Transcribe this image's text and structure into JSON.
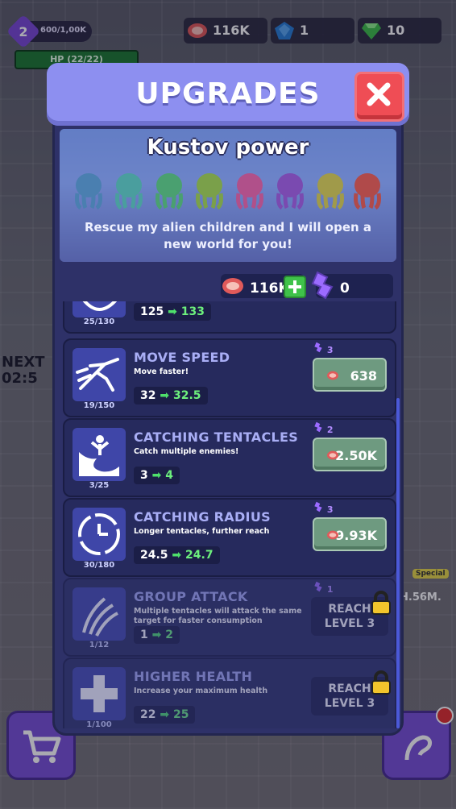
{
  "hud": {
    "level": "2",
    "xp": "600/1,00K",
    "hp": "HP (22/22)",
    "meat": "116K",
    "crystals": "1",
    "gems": "10"
  },
  "background": {
    "next_label": "NEXT",
    "timer": "02:5"
  },
  "dialog": {
    "title": "UPGRADES",
    "banner_title": "Kustov power",
    "banner_desc": "Rescue my alien children and I will open a new world for you!"
  },
  "currency": {
    "meat": "116K",
    "tokens": "0"
  },
  "upgrades": [
    {
      "name": "",
      "desc": "",
      "level": "25/130",
      "current": "125",
      "next": "133",
      "cost_tokens": "",
      "price": ""
    },
    {
      "name": "MOVE SPEED",
      "desc": "Move faster!",
      "level": "19/150",
      "current": "32",
      "next": "32.5",
      "cost_tokens": "3",
      "price": "638"
    },
    {
      "name": "CATCHING TENTACLES",
      "desc": "Catch multiple enemies!",
      "level": "3/25",
      "current": "3",
      "next": "4",
      "cost_tokens": "2",
      "price": "2.50K"
    },
    {
      "name": "CATCHING RADIUS",
      "desc": "Longer tentacles, further reach",
      "level": "30/180",
      "current": "24.5",
      "next": "24.7",
      "cost_tokens": "3",
      "price": "9.93K"
    },
    {
      "name": "GROUP ATTACK",
      "desc": "Multiple tentacles will attack the same target for faster consumption",
      "level": "1/12",
      "current": "1",
      "next": "2",
      "cost_tokens": "1",
      "locked_label_1": "REACH",
      "locked_label_2": "LEVEL 3"
    },
    {
      "name": "HIGHER HEALTH",
      "desc": "Increase your maximum health",
      "level": "1/100",
      "current": "22",
      "next": "25",
      "locked_label_1": "REACH",
      "locked_label_2": "LEVEL 3"
    }
  ],
  "side": {
    "special_tag": "Special",
    "special_value": "H.56M."
  },
  "colors": {
    "header": "#8d8ff0",
    "panel": "#2e3168",
    "close": "#ef4d55",
    "buy": "#6e9a80",
    "arrow": "#4ee06b",
    "token": "#b28cff"
  },
  "icons": [
    "level-badge-icon",
    "meat-icon",
    "crystal-icon",
    "gem-icon",
    "close-icon",
    "plus-icon",
    "token-icon",
    "move-speed-icon",
    "tentacles-icon",
    "radius-icon",
    "group-attack-icon",
    "health-icon",
    "lock-icon",
    "cart-icon",
    "special-icon"
  ]
}
